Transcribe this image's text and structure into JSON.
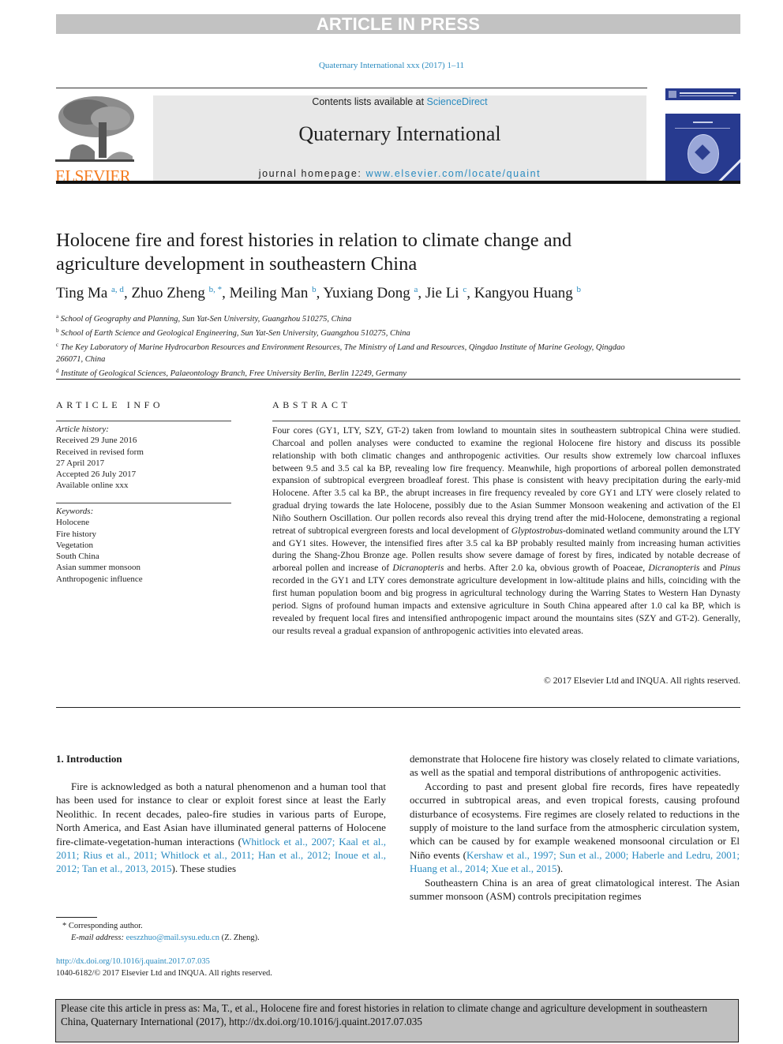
{
  "banner": {
    "text": "ARTICLE IN PRESS"
  },
  "journal_ref": "Quaternary International xxx (2017) 1–11",
  "publisher": {
    "name": "ELSEVIER",
    "brand_color": "#f47b20"
  },
  "masthead": {
    "contents_prefix": "Contents lists available at ",
    "contents_link": "ScienceDirect",
    "journal_title": "Quaternary International",
    "homepage_prefix": "journal homepage: ",
    "homepage_link": "www.elsevier.com/locate/quaint",
    "background_color": "#e8e8e8"
  },
  "cover": {
    "icon": "journal-cover-thumbnail",
    "color": "#273a8f"
  },
  "article": {
    "title": "Holocene fire and forest histories in relation to climate change and agriculture development in southeastern China",
    "authors": [
      {
        "name": "Ting Ma",
        "sup": "a, d"
      },
      {
        "name": "Zhuo Zheng",
        "sup": "b, *"
      },
      {
        "name": "Meiling Man",
        "sup": "b"
      },
      {
        "name": "Yuxiang Dong",
        "sup": "a"
      },
      {
        "name": "Jie Li",
        "sup": "c"
      },
      {
        "name": "Kangyou Huang",
        "sup": "b"
      }
    ],
    "affiliations": [
      {
        "key": "a",
        "text": "School of Geography and Planning, Sun Yat-Sen University, Guangzhou 510275, China"
      },
      {
        "key": "b",
        "text": "School of Earth Science and Geological Engineering, Sun Yat-Sen University, Guangzhou 510275, China"
      },
      {
        "key": "c",
        "text": "The Key Laboratory of Marine Hydrocarbon Resources and Environment Resources, The Ministry of Land and Resources, Qingdao Institute of Marine Geology, Qingdao 266071, China"
      },
      {
        "key": "d",
        "text": "Institute of Geological Sciences, Palaeontology Branch, Free University Berlin, Berlin 12249, Germany"
      }
    ]
  },
  "article_info": {
    "heading": "ARTICLE INFO",
    "history_label": "Article history:",
    "history": [
      "Received 29 June 2016",
      "Received in revised form",
      "27 April 2017",
      "Accepted 26 July 2017",
      "Available online xxx"
    ],
    "keywords_label": "Keywords:",
    "keywords": [
      "Holocene",
      "Fire history",
      "Vegetation",
      "South China",
      "Asian summer monsoon",
      "Anthropogenic influence"
    ]
  },
  "abstract": {
    "heading": "ABSTRACT",
    "p1": "Four cores (GY1, LTY, SZY, GT-2) taken from lowland to mountain sites in southeastern subtropical China were studied. Charcoal and pollen analyses were conducted to examine the regional Holocene fire history and discuss its possible relationship with both climatic changes and anthropogenic activities. Our results show extremely low charcoal influxes between 9.5 and 3.5 cal ka BP, revealing low fire frequency. Meanwhile, high proportions of arboreal pollen demonstrated expansion of subtropical evergreen broadleaf forest. This phase is consistent with heavy precipitation during the early-mid Holocene. After 3.5 cal ka BP., the abrupt increases in fire frequency revealed by core GY1 and LTY were closely related to gradual drying towards the late Holocene, possibly due to the Asian Summer Monsoon weakening and activation of the El Niño Southern Oscillation. Our pollen records also reveal this drying trend after the mid-Holocene, demonstrating a regional retreat of subtropical evergreen forests and local development of ",
    "glyptostrobus": "Glyptostrobus",
    "p2": "-dominated wetland community around the LTY and GY1 sites. However, the intensified fires after 3.5 cal ka BP probably resulted mainly from increasing human activities during the Shang-Zhou Bronze age. Pollen results show severe damage of forest by fires, indicated by notable decrease of arboreal pollen and increase of ",
    "dicranopteris": "Dicranopteris",
    "p3": " and herbs. After 2.0 ka, obvious growth of Poaceae, ",
    "p4": " and ",
    "pinus": "Pinus",
    "p5": " recorded in the GY1 and LTY cores demonstrate agriculture development in low-altitude plains and hills, coinciding with the first human population boom and big progress in agricultural technology during the Warring States to Western Han Dynasty period. Signs of profound human impacts and extensive agriculture in South China appeared after 1.0 cal ka BP, which is revealed by frequent local fires and intensified anthropogenic impact around the mountains sites (SZY and GT-2). Generally, our results reveal a gradual expansion of anthropogenic activities into elevated areas.",
    "copyright": "© 2017 Elsevier Ltd and INQUA. All rights reserved."
  },
  "introduction": {
    "heading": "1.  Introduction",
    "left_p1_text": "Fire is acknowledged as both a natural phenomenon and a human tool that has been used for instance to clear or exploit forest since at least the Early Neolithic. In recent decades, paleo-fire studies in various parts of Europe, North America, and East Asian have illuminated general patterns of Holocene fire-climate-vegetation-human interactions (",
    "left_p1_citations": "Whitlock et al., 2007; Kaal et al., 2011; Rius et al., 2011; Whitlock et al., 2011; Han et al., 2012; Inoue et al., 2012; Tan et al., 2013, 2015",
    "left_p1_tail": "). These studies",
    "right_p1": "demonstrate that Holocene fire history was closely related to climate variations, as well as the spatial and temporal distributions of anthropogenic activities.",
    "right_p2_text": "According to past and present global fire records, fires have repeatedly occurred in subtropical areas, and even tropical forests, causing profound disturbance of ecosystems. Fire regimes are closely related to reductions in the supply of moisture to the land surface from the atmospheric circulation system, which can be caused by for example weakened monsoonal circulation or El Niño events (",
    "right_p2_citations": "Kershaw et al., 1997; Sun et al., 2000; Haberle and Ledru, 2001; Huang et al., 2014; Xue et al., 2015",
    "right_p2_tail": ").",
    "right_p3": "Southeastern China is an area of great climatological interest. The Asian summer monsoon (ASM) controls precipitation regimes"
  },
  "footnote": {
    "corresponding": "* Corresponding author.",
    "email_label": "E-mail address:",
    "email": "eeszzhuo@mail.sysu.edu.cn",
    "email_suffix": " (Z. Zheng)."
  },
  "doi": {
    "link": "http://dx.doi.org/10.1016/j.quaint.2017.07.035",
    "issn_line": "1040-6182/© 2017 Elsevier Ltd and INQUA. All rights reserved."
  },
  "cite_box": {
    "text": "Please cite this article in press as: Ma, T., et al., Holocene fire and forest histories in relation to climate change and agriculture development in southeastern China, Quaternary International (2017), http://dx.doi.org/10.1016/j.quaint.2017.07.035"
  },
  "colors": {
    "link": "#2a8bc0",
    "banner": "#c2c2c2",
    "cite_box": "#c0c0c0"
  }
}
